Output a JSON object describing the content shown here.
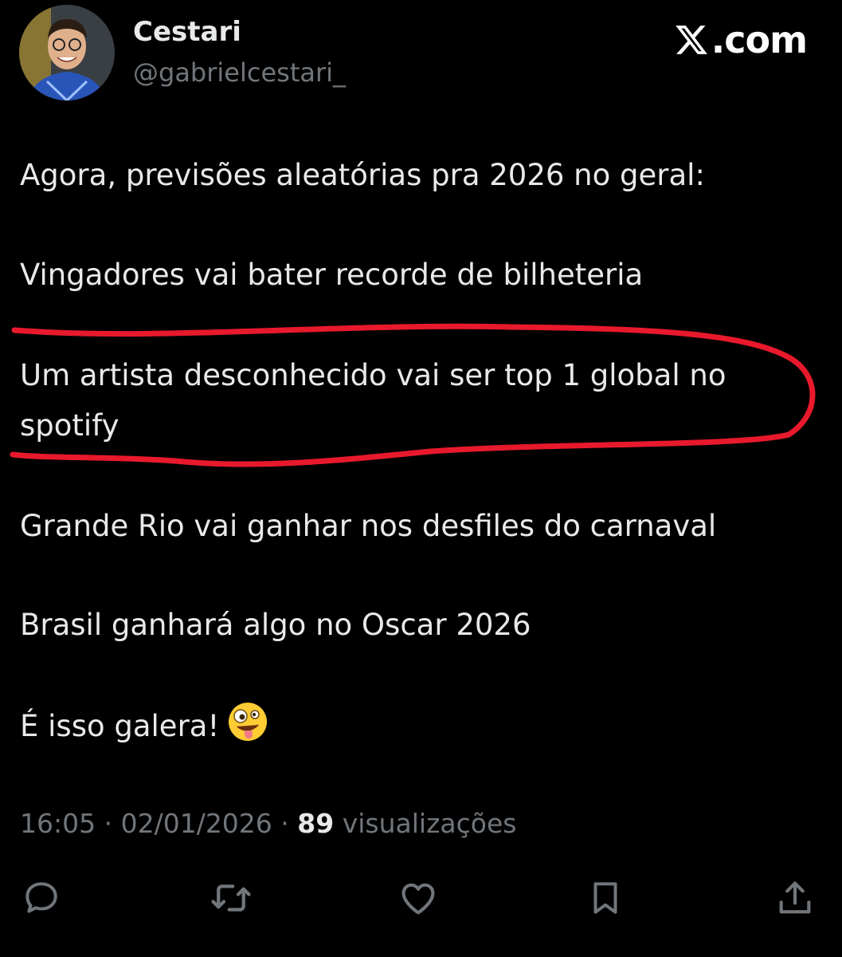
{
  "header": {
    "display_name": "Cestari",
    "handle": "@gabrielcestari_",
    "brand_text": ".com",
    "brand_icon": "x-logo-icon"
  },
  "tweet": {
    "lines": [
      "Agora, previsões aleatórias pra 2026 no geral:",
      "Vingadores vai bater recorde de bilheteria",
      "Um artista desconhecido vai ser top 1 global no",
      "spotify",
      "Grande Rio vai ganhar nos desfiles do carnaval",
      "Brasil ganhará algo no Oscar 2026",
      "É isso galera!"
    ],
    "emoji": "zany-face-emoji",
    "highlight_color": "#e8192c"
  },
  "meta": {
    "time": "16:05",
    "separator": " · ",
    "date": "02/01/2026",
    "views_count": "89",
    "views_label": "visualizações"
  },
  "actions": {
    "icons": [
      "reply-icon",
      "retweet-icon",
      "like-icon",
      "bookmark-icon",
      "share-icon"
    ],
    "icon_color": "#71767b"
  },
  "colors": {
    "background": "#000000",
    "text": "#e7e9ea",
    "secondary_text": "#71767b"
  }
}
